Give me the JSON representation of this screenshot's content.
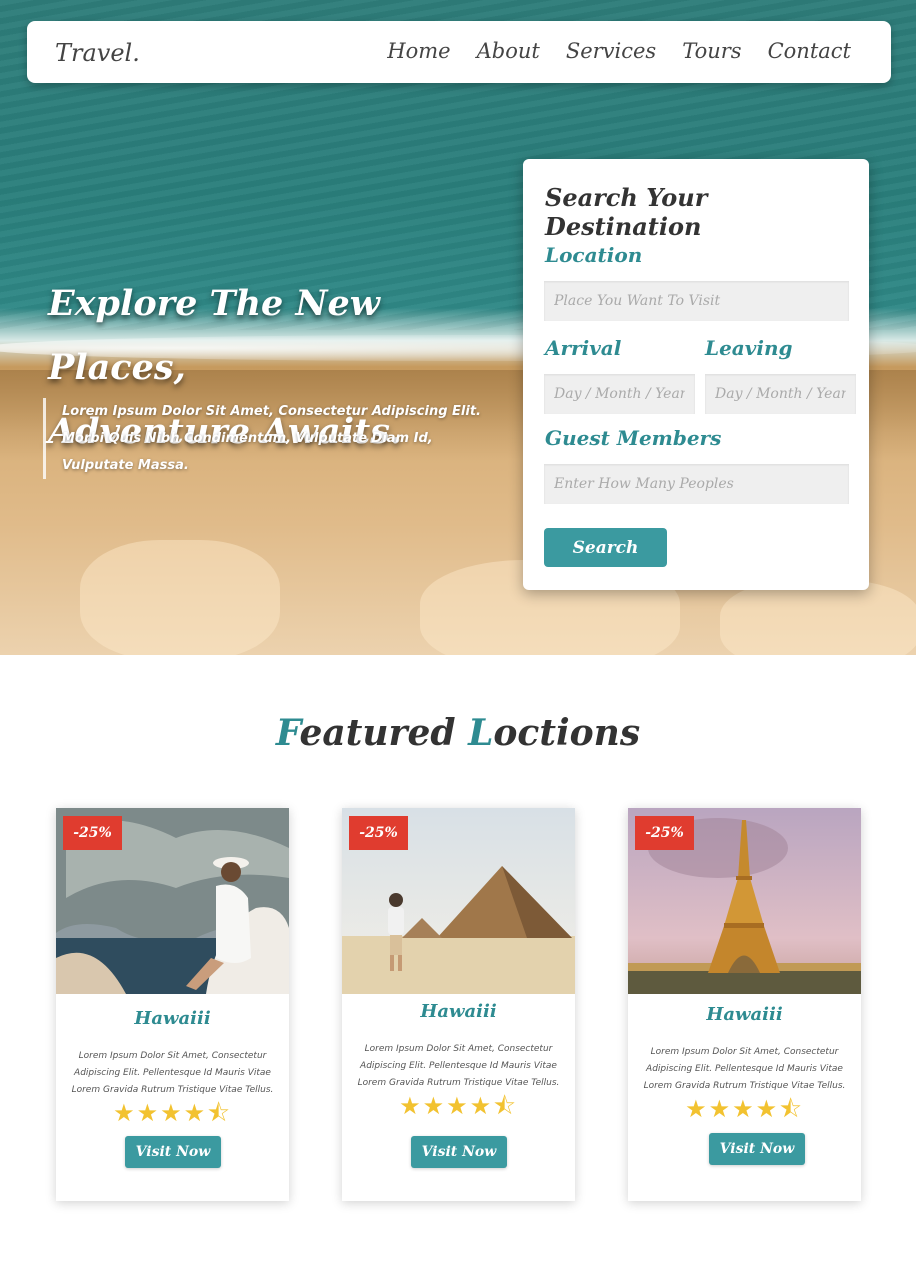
{
  "nav": {
    "brand": "Travel.",
    "links": [
      "Home",
      "About",
      "Services",
      "Tours",
      "Contact"
    ]
  },
  "hero": {
    "title_line1": "Explore The New Places,",
    "title_line2": "Adventure Awaits.",
    "description": "Lorem Ipsum Dolor Sit Amet, Consectetur Adipiscing Elit. Morbi Quis Nibh Condimentum, Vulputate Diam Id, Vulputate Massa."
  },
  "search": {
    "title": "Search Your Destination",
    "location_label": "Location",
    "location_placeholder": "Place You Want To Visit",
    "arrival_label": "Arrival",
    "arrival_placeholder": "Day / Month / Year",
    "leaving_label": "Leaving",
    "leaving_placeholder": "Day / Month / Year",
    "guests_label": "Guest Members",
    "guests_placeholder": "Enter How Many Peoples",
    "button": "Search"
  },
  "featured": {
    "title_accent1": "F",
    "title_part1": "eatured ",
    "title_accent2": "L",
    "title_part2": "octions",
    "cards": [
      {
        "badge": "-25%",
        "title": "Hawaiii",
        "description": "Lorem Ipsum Dolor Sit Amet, Consectetur Adipiscing Elit. Pellentesque Id Mauris Vitae Lorem Gravida Rutrum Tristique Vitae Tellus.",
        "rating": 4.5,
        "stars": "★★★★⯪",
        "button": "Visit Now"
      },
      {
        "badge": "-25%",
        "title": "Hawaiii",
        "description": "Lorem Ipsum Dolor Sit Amet, Consectetur Adipiscing Elit. Pellentesque Id Mauris Vitae Lorem Gravida Rutrum Tristique Vitae Tellus.",
        "rating": 4.5,
        "stars": "★★★★⯪",
        "button": "Visit Now"
      },
      {
        "badge": "-25%",
        "title": "Hawaiii",
        "description": "Lorem Ipsum Dolor Sit Amet, Consectetur Adipiscing Elit. Pellentesque Id Mauris Vitae Lorem Gravida Rutrum Tristique Vitae Tellus.",
        "rating": 4.5,
        "stars": "★★★★⯪",
        "button": "Visit Now"
      }
    ]
  },
  "colors": {
    "accent": "#3b9aa0",
    "badge": "#e03c2f",
    "star": "#f2c230",
    "heading": "#333333"
  }
}
